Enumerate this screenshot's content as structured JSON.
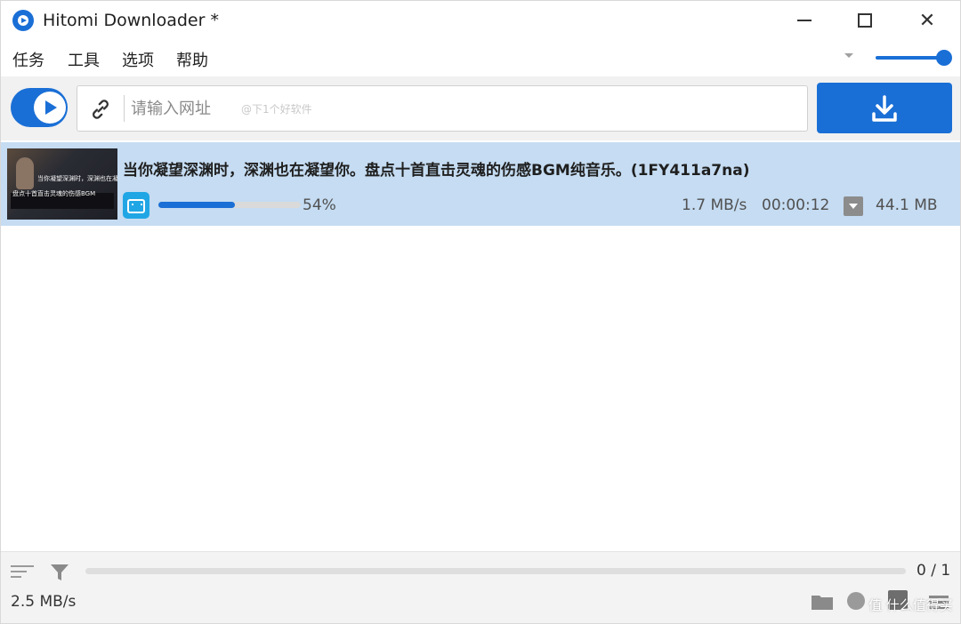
{
  "window": {
    "title": "Hitomi Downloader *",
    "controls": {
      "minimize": "minimize-icon",
      "maximize": "maximize-icon",
      "close": "✕"
    }
  },
  "menu": {
    "items": [
      "任务",
      "工具",
      "选项",
      "帮助"
    ],
    "speed_slider_level": 1.0
  },
  "toolbar": {
    "url_placeholder": "请输入网址",
    "url_watermark": "@下1个好软件",
    "link_icon": "link-icon",
    "download_icon": "download-icon",
    "toggle_state": "on"
  },
  "tasks": [
    {
      "thumbnail_caption_line1": "当你凝望深渊时，深渊也在凝望",
      "thumbnail_caption_line2": "盘点十首直击灵魂的伤感BGM",
      "title": "当你凝望深渊时，深渊也在凝望你。盘点十首直击灵魂的伤感BGM纯音乐。(1FY411a7na)",
      "source_icon": "bilibili-icon",
      "progress_percent": 54,
      "progress_label": "54%",
      "speed": "1.7 MB/s",
      "eta": "00:00:12",
      "size": "44.1 MB"
    }
  ],
  "status": {
    "count": "0 / 1",
    "total_speed": "2.5 MB/s",
    "watermark": "值 什么值得买"
  },
  "colors": {
    "accent": "#1a6fd6",
    "selected_row": "#c5dcf2",
    "status_bar": "#f3f3f3",
    "bilibili": "#21a6e5"
  }
}
